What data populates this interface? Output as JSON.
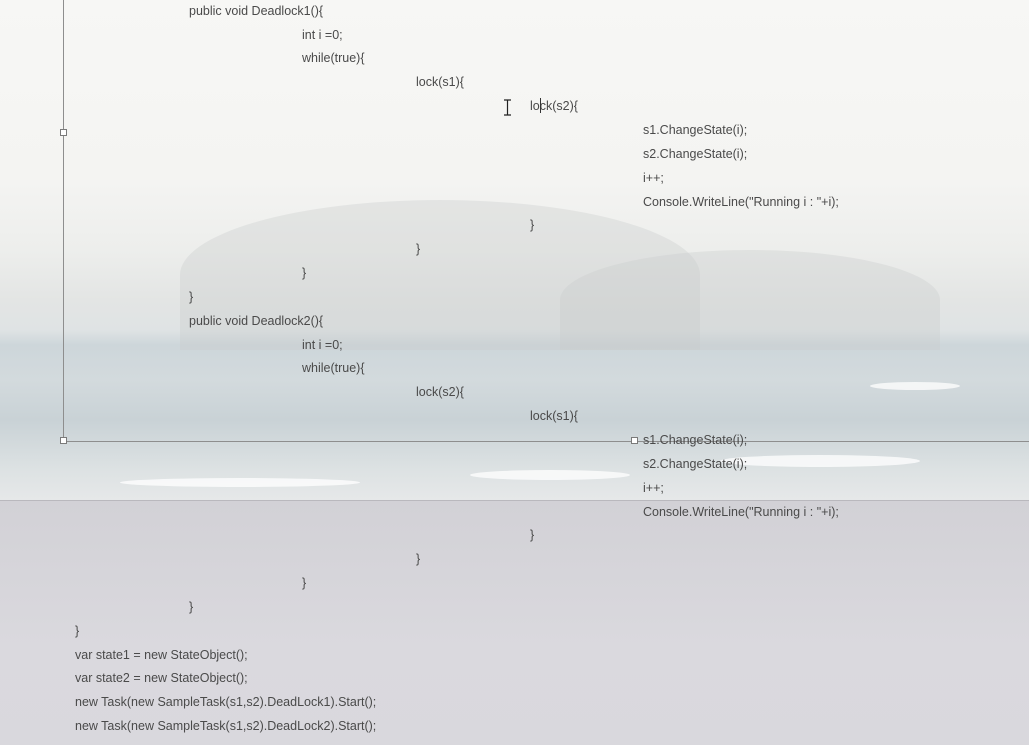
{
  "code": {
    "lines": [
      "public void Deadlock1(){",
      "int i =0;",
      "while(true){",
      "lock(s1){",
      "lock(s2){",
      "s1.ChangeState(i);",
      "s2.ChangeState(i);",
      "i++;",
      "Console.WriteLine(\"Running i : \"+i);",
      "}",
      "}",
      "}",
      "}",
      "public void Deadlock2(){",
      "int i =0;",
      "while(true){",
      "lock(s2){",
      "lock(s1){",
      "s1.ChangeState(i);",
      "s2.ChangeState(i);",
      "i++;",
      "Console.WriteLine(\"Running i : \"+i);",
      "}",
      "}",
      "}",
      "}",
      "}",
      "var state1 = new StateObject();",
      "var state2 = new StateObject();",
      "new Task(new SampleTask(s1,s2).DeadLock1).Start();",
      "new Task(new SampleTask(s1,s2).DeadLock2).Start();"
    ]
  },
  "icons": {
    "cursor": "text-ibeam-cursor-icon",
    "handles": "resize-handle-icon"
  }
}
